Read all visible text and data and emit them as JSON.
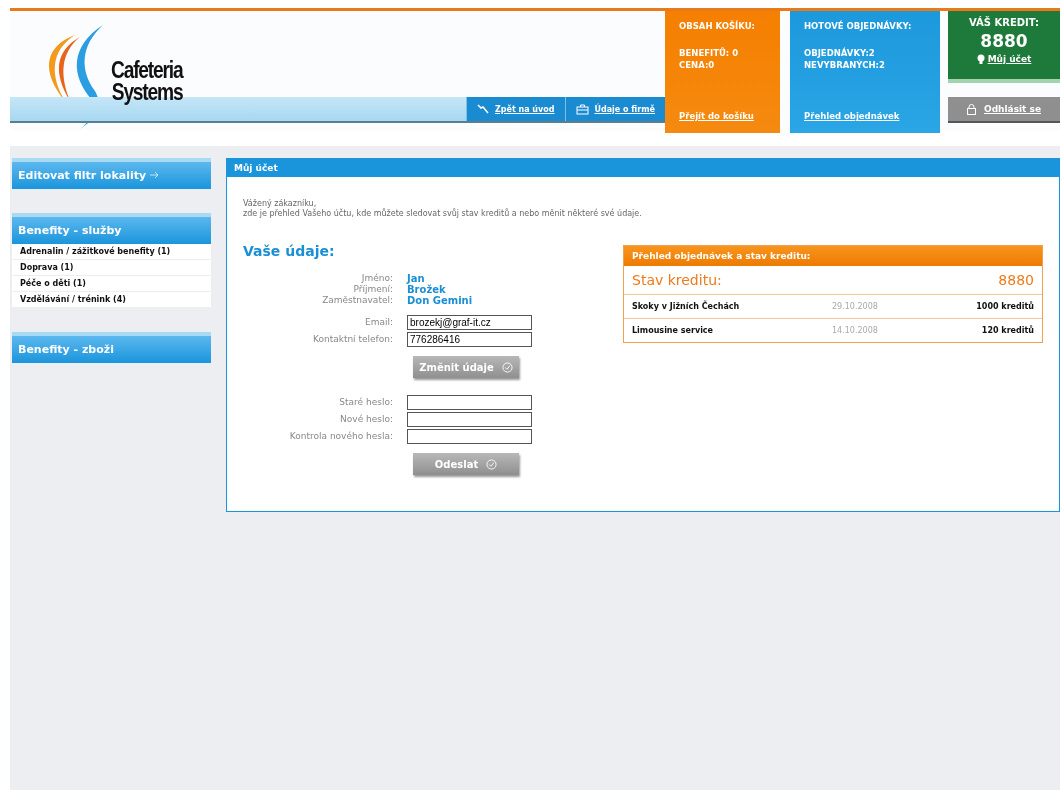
{
  "logo": {
    "line1": "Cafeteria",
    "line2": "Systems"
  },
  "nav": [
    {
      "label": "Zpět na úvod"
    },
    {
      "label": "Údaje o firmě"
    }
  ],
  "cart": {
    "title": "OBSAH KOŠÍKU:",
    "lines": [
      "BENEFITŮ: 0",
      "CENA:0"
    ],
    "link": "Přejít do košíku"
  },
  "orders": {
    "title": "HOTOVÉ OBJEDNÁVKY:",
    "lines": [
      "OBJEDNÁVKY:2",
      "NEVYBRANÝCH:2"
    ],
    "link": "Přehled objednávek"
  },
  "credit": {
    "title": "VÁŠ KREDIT:",
    "amount": "8880",
    "link": "Můj účet"
  },
  "logout": "Odhlásit se",
  "sidebar": [
    {
      "title": "Editovat filtr lokality",
      "arrow": true
    },
    {
      "title": "Benefity - služby",
      "arrow": false,
      "items": [
        "Adrenalin / zážitkové benefity (1)",
        "Doprava (1)",
        "Péče o děti (1)",
        "Vzdělávání / trénink (4)"
      ]
    },
    {
      "title": "Benefity - zboži",
      "arrow": false
    }
  ],
  "panel": {
    "title": "Můj účet",
    "greeting": "Vážený zákazníku,",
    "intro": "zde je přehled Vašeho účtu, kde můžete sledovat svůj stav kreditů a nebo měnit některé své údaje.",
    "heading": "Vaše údaje:",
    "info": [
      {
        "label": "Jméno:",
        "value": "Jan"
      },
      {
        "label": "Příjmení:",
        "value": "Brožek"
      },
      {
        "label": "Zaměstnavatel:",
        "value": "Don Gemini"
      }
    ],
    "contact": [
      {
        "label": "Email:",
        "value": "brozekj@graf-it.cz"
      },
      {
        "label": "Kontaktní telefon:",
        "value": "776286416"
      }
    ],
    "save_button": "Změnit údaje",
    "password": [
      {
        "label": "Staré heslo:"
      },
      {
        "label": "Nové heslo:"
      },
      {
        "label": "Kontrola nového hesla:"
      }
    ],
    "send_button": "Odeslat"
  },
  "overview": {
    "title": "Přehled objednávek a stav kreditu:",
    "balance_label": "Stav kreditu:",
    "balance": "8880",
    "rows": [
      {
        "name": "Skoky v Jižních Čechách",
        "date": "29.10.2008",
        "amount": "1000 kreditů"
      },
      {
        "name": "Limousine service",
        "date": "14.10.2008",
        "amount": "120 kreditů"
      }
    ]
  }
}
